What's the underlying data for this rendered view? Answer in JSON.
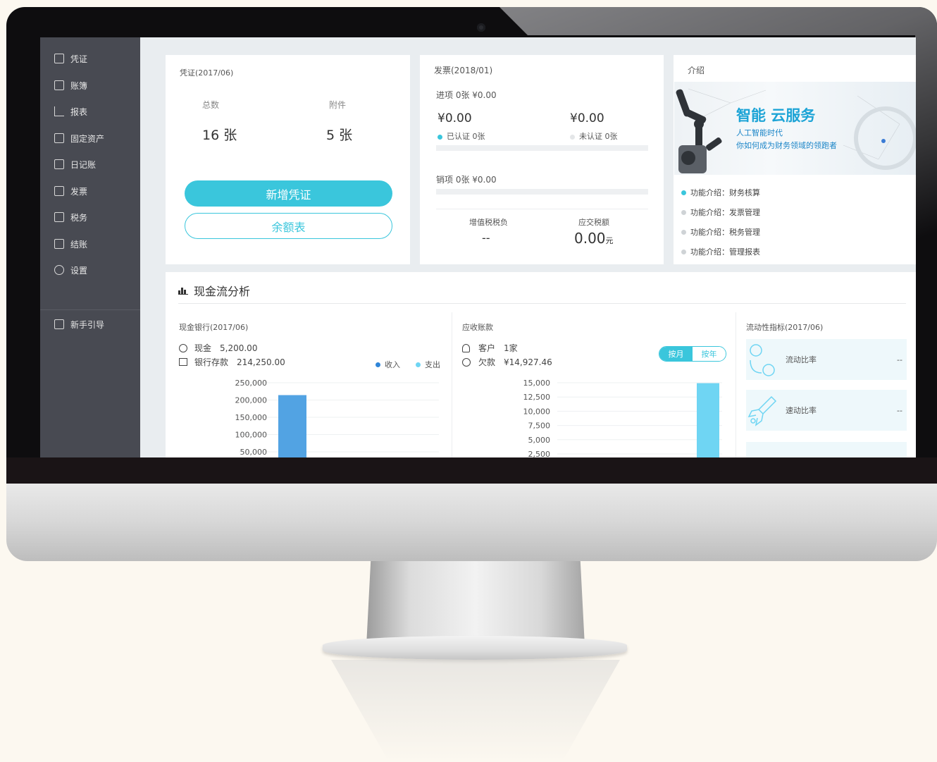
{
  "sidebar": {
    "items": [
      {
        "label": "凭证",
        "icon": "voucher-icon"
      },
      {
        "label": "账簿",
        "icon": "ledger-icon"
      },
      {
        "label": "报表",
        "icon": "report-chart-icon"
      },
      {
        "label": "固定资产",
        "icon": "building-icon"
      },
      {
        "label": "日记账",
        "icon": "journal-icon"
      },
      {
        "label": "发票",
        "icon": "invoice-icon"
      },
      {
        "label": "税务",
        "icon": "tax-icon"
      },
      {
        "label": "结账",
        "icon": "checkout-icon"
      },
      {
        "label": "设置",
        "icon": "gear-icon"
      }
    ],
    "guide": {
      "label": "新手引导",
      "icon": "gift-icon"
    }
  },
  "voucher_card": {
    "title": "凭证(2017/06)",
    "total_label": "总数",
    "total_value": "16 张",
    "attach_label": "附件",
    "attach_value": "5 张",
    "add_button": "新增凭证",
    "balance_button": "余额表"
  },
  "invoice_card": {
    "title": "发票(2018/01)",
    "input_line": "进项 0张  ¥0.00",
    "certified_amount": "¥0.00",
    "uncertified_amount": "¥0.00",
    "certified_label": "已认证  0张",
    "uncertified_label": "未认证  0张",
    "output_line": "销项   0张    ¥0.00",
    "vat_label": "增值税税负",
    "vat_value": "--",
    "tax_due_label": "应交税额",
    "tax_due_value": "0.00",
    "tax_due_unit": "元"
  },
  "intro_card": {
    "title": "介绍",
    "promo_title": "智能 云服务",
    "promo_line1": "人工智能时代",
    "promo_line2": "你如何成为财务领域的领跑者",
    "items": [
      "功能介绍：财务核算",
      "功能介绍：发票管理",
      "功能介绍：税务管理",
      "功能介绍：管理报表"
    ]
  },
  "cashflow": {
    "title": "现金流分析",
    "bank": {
      "title": "现金银行(2017/06)",
      "cash_label": "现金",
      "cash_value": "5,200.00",
      "deposit_label": "银行存款",
      "deposit_value": "214,250.00",
      "legend_income": "收入",
      "legend_expense": "支出"
    },
    "receivable": {
      "title": "应收账款",
      "customer_label": "客户",
      "customer_value": "1家",
      "owed_label": "欠款",
      "owed_value": "¥14,927.46",
      "toggle_month": "按月",
      "toggle_year": "按年"
    },
    "liquidity": {
      "title": "流动性指标(2017/06)",
      "current_ratio_label": "流动比率",
      "current_ratio_value": "--",
      "quick_ratio_label": "速动比率",
      "quick_ratio_value": "--"
    }
  },
  "colors": {
    "accent": "#3ac6dc",
    "income_bar": "#52a3e3",
    "expense_bar": "#6fd5f3",
    "sidebar": "#484a52"
  },
  "chart_data": [
    {
      "type": "bar",
      "title": "现金银行(2017/06)",
      "categories": [
        "",
        ""
      ],
      "series": [
        {
          "name": "收入",
          "values": [
            214250,
            0
          ]
        },
        {
          "name": "支出",
          "values": [
            0,
            5200
          ]
        }
      ],
      "yticks": [
        "250,000",
        "200,000",
        "150,000",
        "100,000",
        "50,000"
      ],
      "ylim": [
        0,
        250000
      ],
      "grid": true,
      "legend": "top-right"
    },
    {
      "type": "bar",
      "title": "应收账款",
      "categories": [
        ""
      ],
      "series": [
        {
          "name": "",
          "values": [
            14927.46
          ]
        }
      ],
      "yticks": [
        "15,000",
        "12,500",
        "10,000",
        "7,500",
        "5,000",
        "2,500"
      ],
      "ylim": [
        0,
        15000
      ],
      "grid": true
    }
  ]
}
